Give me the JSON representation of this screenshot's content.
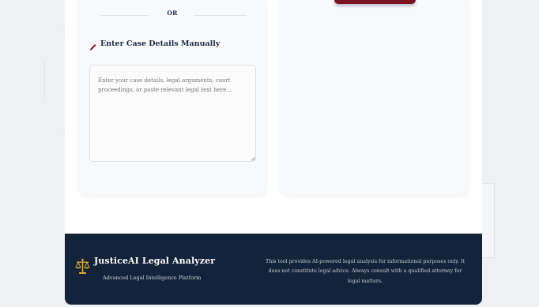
{
  "divider": {
    "or_label": "OR"
  },
  "manual_entry": {
    "title": "Enter Case Details Manually",
    "textarea_placeholder": "Enter your case details, legal arguments, court proceedings, or paste relevant legal text here...",
    "textarea_value": ""
  },
  "footer": {
    "brand": "JusticeAI Legal Analyzer",
    "tagline": "Advanced Legal Intelligence Platform",
    "disclaimer": "This tool provides AI-powered legal analysis for informational purposes only. It does not constitute legal advice. Always consult with a qualified attorney for legal matters.",
    "logo_icon": "scales-of-justice-icon"
  },
  "colors": {
    "navy": "#13233a",
    "accent_red": "#a11b22",
    "gold": "#d8a431",
    "heading": "#1a2a44"
  }
}
